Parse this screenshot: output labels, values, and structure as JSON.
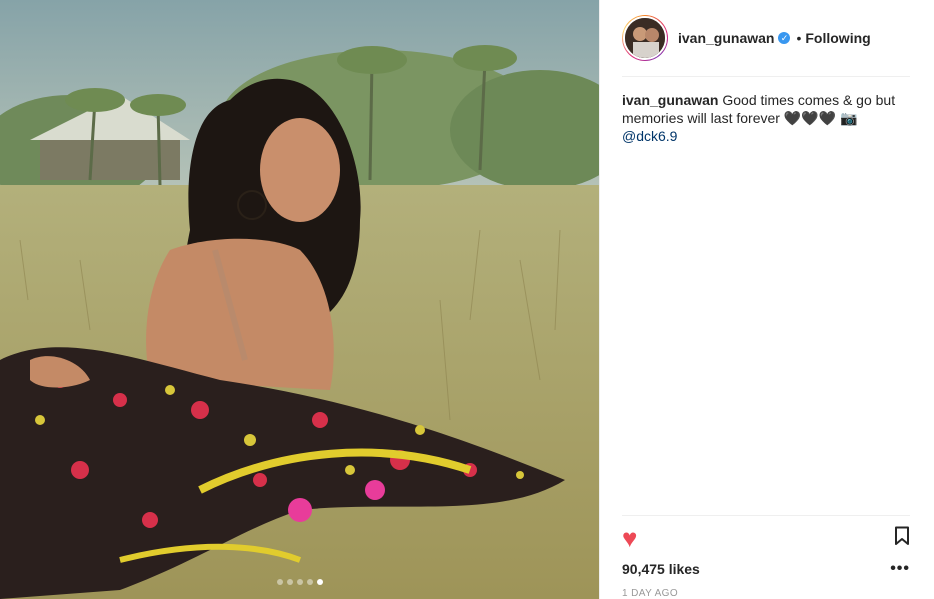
{
  "post": {
    "author": {
      "username": "ivan_gunawan",
      "verified_icon": "verified-badge-icon",
      "follow_separator": "•",
      "follow_status": "Following"
    },
    "caption": {
      "username": "ivan_gunawan",
      "text": " Good times comes & go but memories will last forever 🖤🖤🖤 📷 ",
      "mention": "@dck6.9"
    },
    "carousel": {
      "count": 5,
      "active_index": 4
    },
    "likes": "90,475 likes",
    "time": "1 DAY AGO",
    "liked": true,
    "more_label": "•••"
  },
  "colors": {
    "like_red": "#ed4956",
    "verified_blue": "#3897f0",
    "mention_blue": "#003569",
    "border": "#efefef"
  }
}
